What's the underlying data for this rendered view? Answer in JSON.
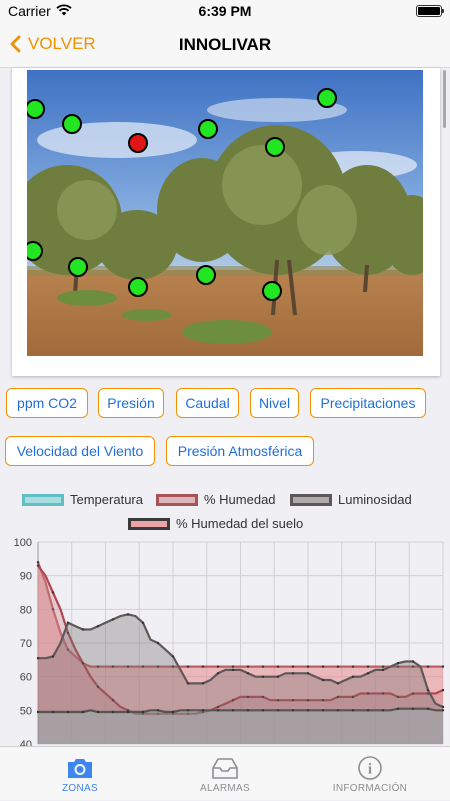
{
  "status_bar": {
    "carrier": "Carrier",
    "time": "6:39 PM"
  },
  "nav": {
    "back_label": "VOLVER",
    "title": "INNOLIVAR"
  },
  "photo": {
    "markers": [
      {
        "status": "ok"
      },
      {
        "status": "ok"
      },
      {
        "status": "alarm"
      },
      {
        "status": "ok"
      },
      {
        "status": "ok"
      },
      {
        "status": "ok"
      },
      {
        "status": "ok"
      },
      {
        "status": "ok"
      },
      {
        "status": "ok"
      },
      {
        "status": "ok"
      },
      {
        "status": "ok"
      }
    ]
  },
  "sensor_buttons": [
    "ppm CO2",
    "Presión",
    "Caudal",
    "Nivel",
    "Precipitaciones",
    "Velocidad del Viento",
    "Presión Atmosférica"
  ],
  "colors": {
    "accent": "#f29100",
    "link": "#1e6fd9",
    "tab_active": "#3d86f0",
    "marker_ok": "#22e622",
    "marker_alarm": "#e01515"
  },
  "chart_data": {
    "type": "area",
    "ylim": [
      40,
      100
    ],
    "yticks": [
      40,
      50,
      60,
      70,
      80,
      90,
      100
    ],
    "grid": true,
    "legend_position": "top",
    "series": [
      {
        "name": "Temperatura",
        "color": "#70c8cc",
        "values": [
          49.5,
          49.5,
          49.5,
          49.5,
          49.5,
          49.5,
          49.5,
          50,
          49.5,
          49.5,
          49.5,
          49.5,
          49.5,
          49.5,
          49.5,
          50,
          50,
          49.5,
          49.5,
          50,
          50,
          50,
          50,
          50,
          50,
          50,
          50,
          50,
          50,
          50,
          50,
          50,
          50,
          50,
          50,
          50,
          50,
          50,
          50,
          50,
          50,
          50,
          50,
          50,
          50,
          50,
          50,
          50,
          50.5,
          50.5,
          50.5,
          50.5,
          50.5,
          50,
          50
        ]
      },
      {
        "name": "% Humedad",
        "color": "#c9858a",
        "values": [
          93,
          90,
          85,
          80,
          73,
          68,
          64,
          60,
          57,
          55,
          53,
          51,
          50,
          49,
          49,
          49,
          49,
          49,
          49,
          49,
          49,
          49,
          49.5,
          50,
          51,
          52,
          53,
          54,
          54,
          54,
          54,
          53,
          53,
          53,
          53,
          53,
          53,
          53,
          53,
          53,
          54,
          54,
          54,
          55,
          55,
          55,
          55,
          55,
          54,
          54,
          55,
          55,
          55,
          55,
          56
        ]
      },
      {
        "name": "Luminosidad",
        "color": "#777070",
        "values": [
          65.5,
          65.5,
          66,
          70,
          76,
          75,
          74,
          74,
          75,
          76,
          77,
          78,
          78.5,
          78,
          76,
          71,
          70,
          68,
          66,
          62,
          58,
          58,
          58,
          59,
          61,
          62,
          62,
          62,
          61,
          60,
          60,
          60,
          60,
          61,
          61,
          61,
          61,
          60,
          59,
          59,
          58,
          59,
          60,
          60,
          61,
          62,
          62,
          63,
          64,
          64.5,
          64.5,
          63,
          56,
          52,
          51
        ]
      },
      {
        "name": "% Humedad del suelo",
        "color": "#e5898d",
        "values": [
          94,
          88,
          80,
          73,
          68,
          66,
          64,
          63,
          63,
          63,
          63,
          63,
          63,
          63,
          63,
          63,
          63,
          63,
          63,
          63,
          63,
          63,
          63,
          63,
          63,
          63,
          63,
          63,
          63,
          63,
          63,
          63,
          63,
          63,
          63,
          63,
          63,
          63,
          63,
          63,
          63,
          63,
          63,
          63,
          63,
          63,
          63,
          63,
          63,
          63,
          63,
          63,
          63,
          63,
          63
        ]
      }
    ]
  },
  "tabs": [
    {
      "label": "ZONAS",
      "active": true
    },
    {
      "label": "ALARMAS",
      "active": false
    },
    {
      "label": "INFORMACIÓN",
      "active": false
    }
  ]
}
